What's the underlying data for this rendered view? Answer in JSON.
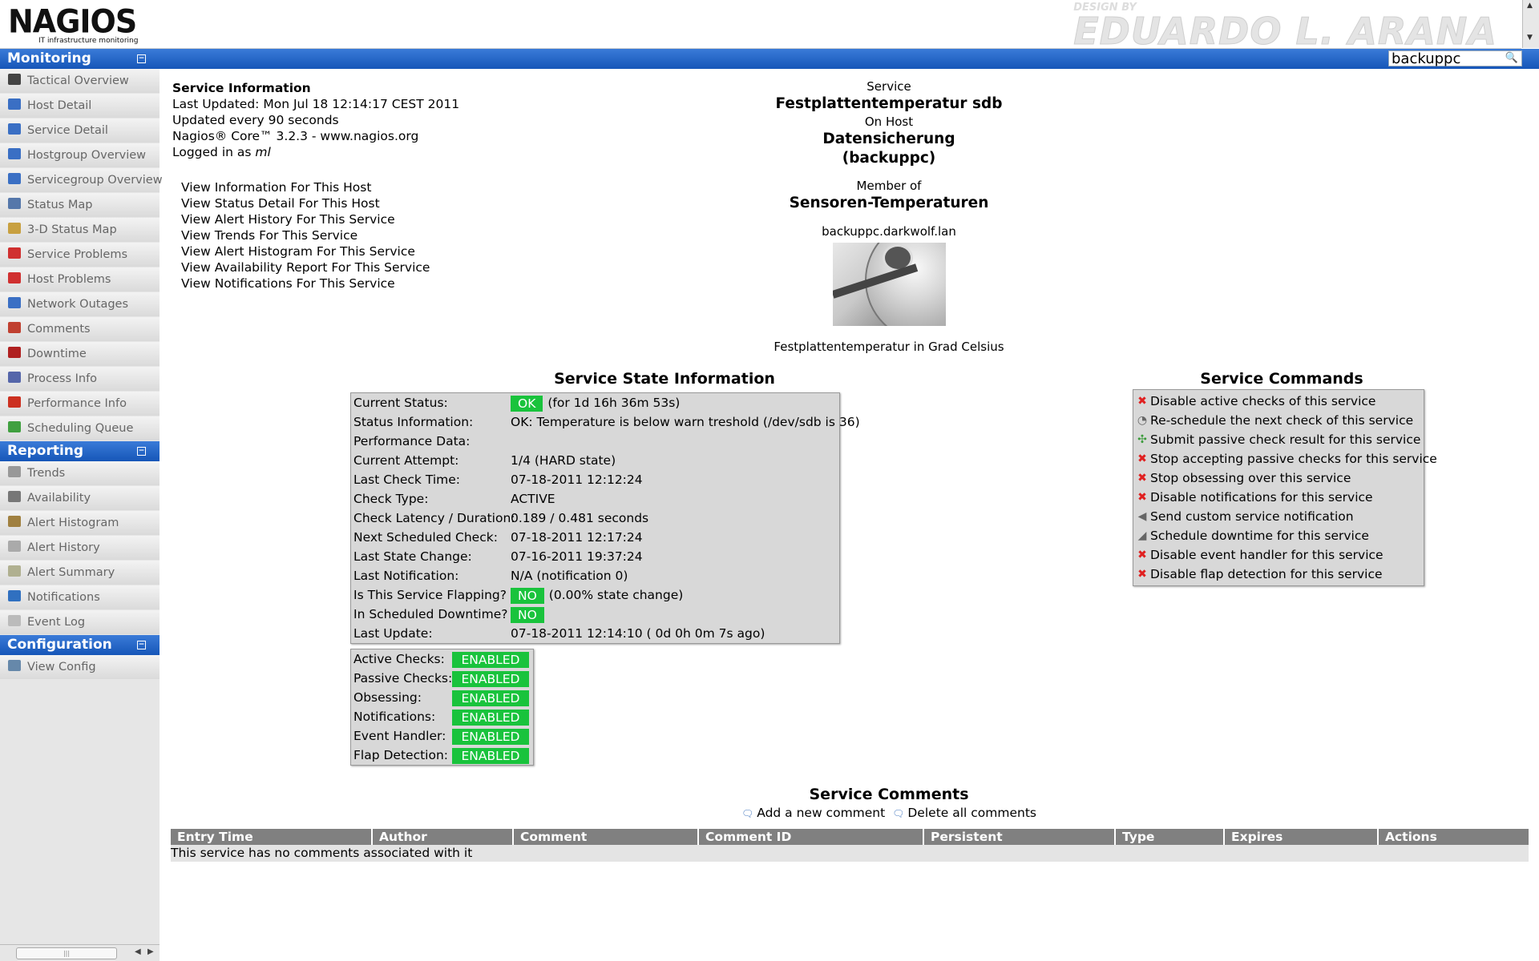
{
  "header": {
    "logo_text": "NAGIOS",
    "logo_subtitle": "IT infrastructure monitoring",
    "design_by": "DESIGN BY",
    "designer": "EDUARDO L. ARANA",
    "search_value": "backuppc"
  },
  "sidebar": {
    "monitoring": {
      "title": "Monitoring",
      "items": [
        {
          "label": "Tactical Overview",
          "color": "#444"
        },
        {
          "label": "Host Detail",
          "color": "#3a6fc4"
        },
        {
          "label": "Service Detail",
          "color": "#3a6fc4"
        },
        {
          "label": "Hostgroup Overview",
          "color": "#3a6fc4"
        },
        {
          "label": "Servicegroup Overview",
          "color": "#3a6fc4"
        },
        {
          "label": "Status Map",
          "color": "#5577aa"
        },
        {
          "label": "3-D Status Map",
          "color": "#c8a040"
        },
        {
          "label": "Service Problems",
          "color": "#d03030"
        },
        {
          "label": "Host Problems",
          "color": "#d03030"
        },
        {
          "label": "Network Outages",
          "color": "#3a6fc4"
        },
        {
          "label": "Comments",
          "color": "#c04030"
        },
        {
          "label": "Downtime",
          "color": "#b02020"
        },
        {
          "label": "Process Info",
          "color": "#5566aa"
        },
        {
          "label": "Performance Info",
          "color": "#cc3020"
        },
        {
          "label": "Scheduling Queue",
          "color": "#40a040"
        }
      ]
    },
    "reporting": {
      "title": "Reporting",
      "items": [
        {
          "label": "Trends",
          "color": "#999"
        },
        {
          "label": "Availability",
          "color": "#777"
        },
        {
          "label": "Alert Histogram",
          "color": "#a08040"
        },
        {
          "label": "Alert History",
          "color": "#aaa"
        },
        {
          "label": "Alert Summary",
          "color": "#b0b090"
        },
        {
          "label": "Notifications",
          "color": "#3070c0"
        },
        {
          "label": "Event Log",
          "color": "#bbb"
        }
      ]
    },
    "configuration": {
      "title": "Configuration",
      "items": [
        {
          "label": "View Config",
          "color": "#6688aa"
        }
      ]
    }
  },
  "info": {
    "heading": "Service Information",
    "last_updated": "Last Updated: Mon Jul 18 12:14:17 CEST 2011",
    "update_interval": "Updated every 90 seconds",
    "version": "Nagios® Core™ 3.2.3 - www.nagios.org",
    "logged_in_prefix": "Logged in as ",
    "logged_in_user": "ml"
  },
  "links": [
    "View Information For This Host",
    "View Status Detail For This Host",
    "View Alert History For This Service",
    "View Trends For This Service",
    "View Alert Histogram For This Service",
    "View Availability Report For This Service",
    "View Notifications For This Service"
  ],
  "service": {
    "label_service": "Service",
    "name": "Festplattentemperatur sdb",
    "label_host": "On Host",
    "host_alias": "Datensicherung",
    "host_name": "(backuppc)",
    "label_member": "Member of",
    "group": "Sensoren-Temperaturen",
    "host_address": "backuppc.darkwolf.lan",
    "notes": "Festplattentemperatur in Grad Celsius"
  },
  "state_info": {
    "title": "Service State Information",
    "rows": [
      {
        "key": "Current Status:",
        "badge": "OK",
        "value": "(for 1d 16h 36m 53s)"
      },
      {
        "key": "Status Information:",
        "badge": "",
        "value": "OK: Temperature is below warn treshold (/dev/sdb is 36)"
      },
      {
        "key": "Performance Data:",
        "badge": "",
        "value": ""
      },
      {
        "key": "Current Attempt:",
        "badge": "",
        "value": "1/4  (HARD state)"
      },
      {
        "key": "Last Check Time:",
        "badge": "",
        "value": "07-18-2011 12:12:24"
      },
      {
        "key": "Check Type:",
        "badge": "",
        "value": "ACTIVE"
      },
      {
        "key": "Check Latency / Duration:",
        "badge": "",
        "value": "0.189 / 0.481 seconds"
      },
      {
        "key": "Next Scheduled Check:",
        "badge": "",
        "value": "07-18-2011 12:17:24"
      },
      {
        "key": "Last State Change:",
        "badge": "",
        "value": "07-16-2011 19:37:24"
      },
      {
        "key": "Last Notification:",
        "badge": "",
        "value": "N/A (notification 0)"
      },
      {
        "key": "Is This Service Flapping?",
        "badge": "NO",
        "value": "(0.00% state change)"
      },
      {
        "key": "In Scheduled Downtime?",
        "badge": "NO",
        "value": ""
      },
      {
        "key": "Last Update:",
        "badge": "",
        "value": "07-18-2011 12:14:10  ( 0d 0h 0m 7s ago)"
      }
    ],
    "ok_color": "#19c33c"
  },
  "flags": [
    {
      "key": "Active Checks:",
      "value": "ENABLED"
    },
    {
      "key": "Passive Checks:",
      "value": "ENABLED"
    },
    {
      "key": "Obsessing:",
      "value": "ENABLED"
    },
    {
      "key": "Notifications:",
      "value": "ENABLED"
    },
    {
      "key": "Event Handler:",
      "value": "ENABLED"
    },
    {
      "key": "Flap Detection:",
      "value": "ENABLED"
    }
  ],
  "commands": {
    "title": "Service Commands",
    "items": [
      {
        "icon": "delete-icon",
        "label": "Disable active checks of this service"
      },
      {
        "icon": "clock-icon",
        "label": "Re-schedule the next check of this service"
      },
      {
        "icon": "passive-icon",
        "label": "Submit passive check result for this service"
      },
      {
        "icon": "delete-icon",
        "label": "Stop accepting passive checks for this service"
      },
      {
        "icon": "delete-icon",
        "label": "Stop obsessing over this service"
      },
      {
        "icon": "delete-icon",
        "label": "Disable notifications for this service"
      },
      {
        "icon": "megaphone-icon",
        "label": "Send custom service notification"
      },
      {
        "icon": "downtime-icon",
        "label": "Schedule downtime for this service"
      },
      {
        "icon": "delete-icon",
        "label": "Disable event handler for this service"
      },
      {
        "icon": "delete-icon",
        "label": "Disable flap detection for this service"
      }
    ]
  },
  "comments": {
    "title": "Service Comments",
    "add_label": "Add a new comment",
    "delete_label": "Delete all comments",
    "columns": [
      "Entry Time",
      "Author",
      "Comment",
      "Comment ID",
      "Persistent",
      "Type",
      "Expires",
      "Actions"
    ],
    "empty_message": "This service has no comments associated with it"
  }
}
